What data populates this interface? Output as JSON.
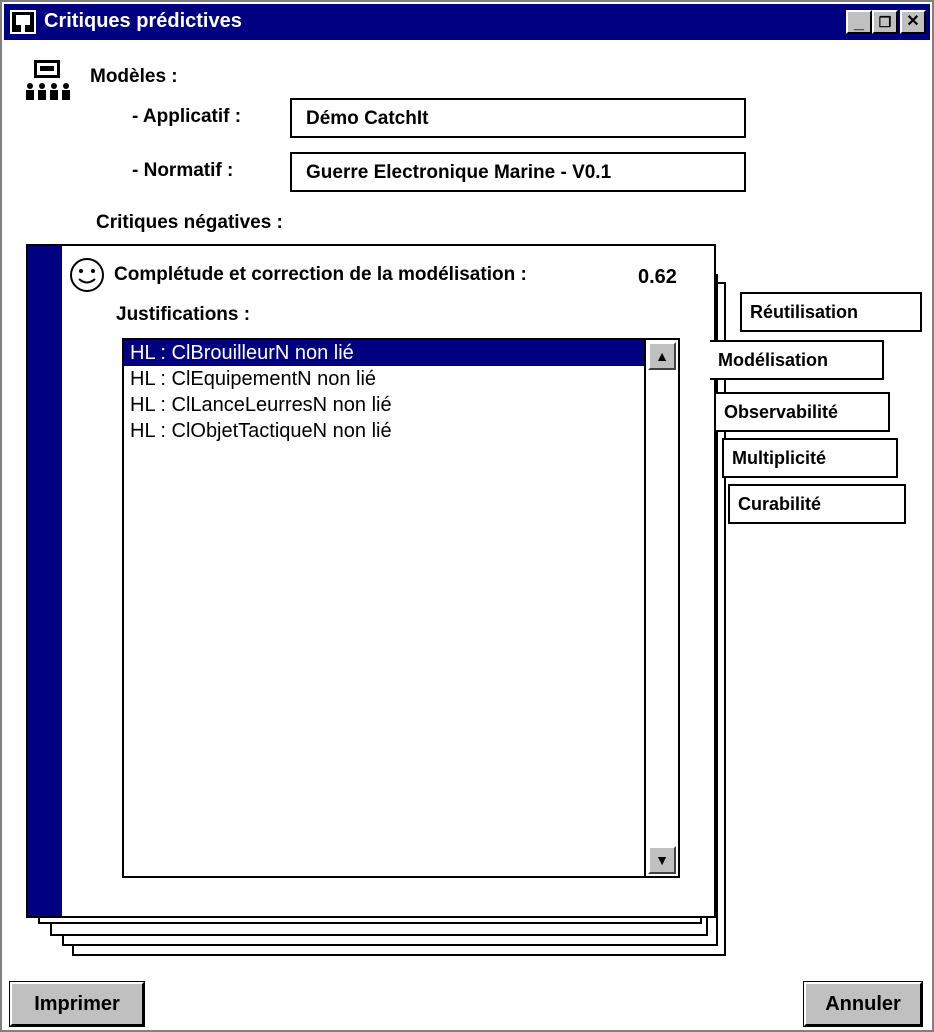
{
  "window": {
    "title": "Critiques prédictives",
    "controls": {
      "minimize": "_",
      "restore": "❒",
      "close": "✕"
    }
  },
  "models": {
    "heading": "Modèles :",
    "applicatif_label": "- Applicatif :",
    "applicatif_value": "Démo CatchIt",
    "normatif_label": "- Normatif :",
    "normatif_value": "Guerre Electronique Marine - V0.1"
  },
  "critiques_label": "Critiques négatives :",
  "panel": {
    "criterion_label": "Complétude et correction de la modélisation :",
    "score": "0.62",
    "justifications_label": "Justifications :",
    "justifications": [
      "HL : ClBrouilleurN non lié",
      "HL : ClEquipementN non lié",
      "HL : ClLanceLeurresN non lié",
      "HL : ClObjetTactiqueN non lié"
    ],
    "selected_index": 0,
    "scroll_up": "▲",
    "scroll_down": "▼"
  },
  "tabs": [
    "Réutilisation",
    "Modélisation",
    "Observabilité",
    "Multiplicité",
    "Curabilité"
  ],
  "active_tab": "Modélisation",
  "buttons": {
    "print": "Imprimer",
    "cancel": "Annuler"
  },
  "colors": {
    "titlebar": "#000080",
    "accent_bar": "#000080",
    "selection": "#000080"
  },
  "icons": {
    "app": "monitor-icon",
    "models": "group-presentation-icon",
    "smiley": "smiley-icon"
  }
}
